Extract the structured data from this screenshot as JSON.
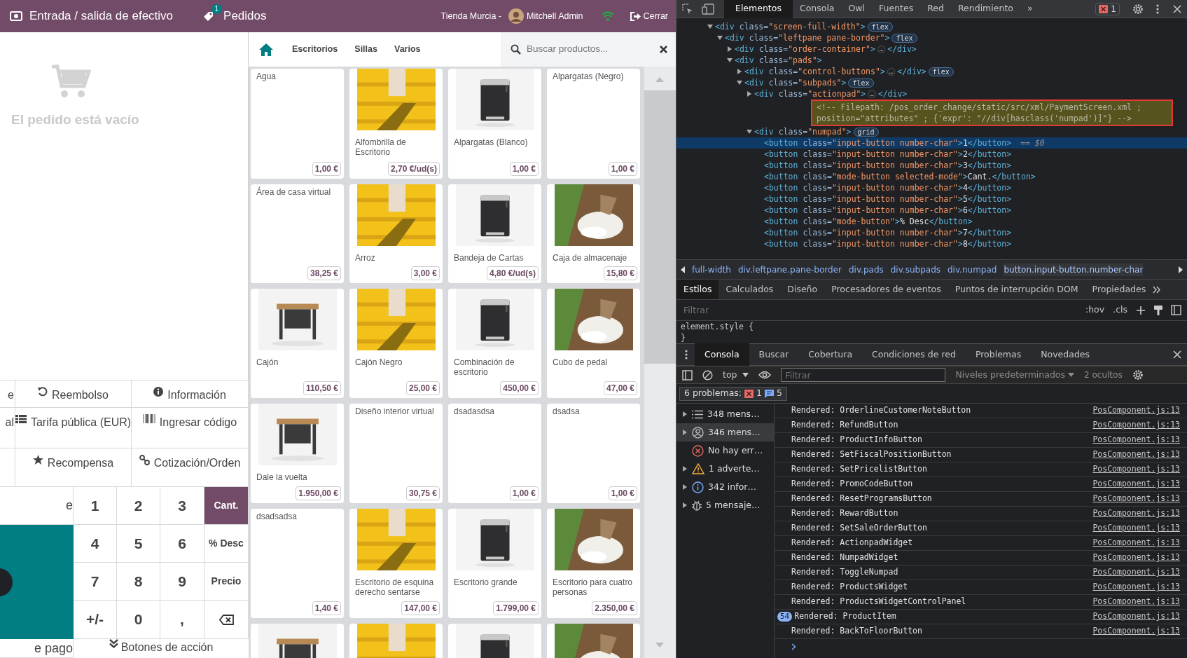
{
  "header": {
    "cash_label": "Entrada / salida de efectivo",
    "orders_count": "1",
    "orders_label": "Pedidos",
    "shop": "Tienda Murcia -",
    "user": "Mitchell Admin",
    "close_label": "Cerrar"
  },
  "order": {
    "empty_text": "El pedido está vacío"
  },
  "control_buttons": [
    [
      {
        "kind": "cut",
        "label": "e"
      },
      {
        "kind": "refund",
        "label": "Reembolso"
      },
      {
        "kind": "info",
        "label": "Información"
      }
    ],
    [
      {
        "kind": "cut",
        "label": "al"
      },
      {
        "kind": "pricelist",
        "label": "Tarifa pública (EUR)"
      },
      {
        "kind": "barcode",
        "label": "Ingresar código"
      }
    ],
    [
      {
        "kind": "cut"
      },
      {
        "kind": "reward",
        "label": "Recompensa"
      },
      {
        "kind": "link",
        "label": "Cotización/Orden"
      }
    ]
  ],
  "numpad": {
    "side_top": "e",
    "side_bottom": "e pago",
    "actions_toggle": "Botones de acción",
    "keys": [
      {
        "kind": "digit",
        "label": "1",
        "selected": false
      },
      {
        "kind": "digit",
        "label": "2",
        "selected": false
      },
      {
        "kind": "digit",
        "label": "3",
        "selected": false
      },
      {
        "kind": "mode",
        "label": "Cant.",
        "selected": true
      },
      {
        "kind": "digit",
        "label": "4",
        "selected": false
      },
      {
        "kind": "digit",
        "label": "5",
        "selected": false
      },
      {
        "kind": "digit",
        "label": "6",
        "selected": false
      },
      {
        "kind": "mode",
        "label": "% Desc",
        "selected": false
      },
      {
        "kind": "digit",
        "label": "7",
        "selected": false
      },
      {
        "kind": "digit",
        "label": "8",
        "selected": false
      },
      {
        "kind": "digit",
        "label": "9",
        "selected": false
      },
      {
        "kind": "mode",
        "label": "Precio",
        "selected": false
      },
      {
        "kind": "digit",
        "label": "+/-",
        "selected": false
      },
      {
        "kind": "digit",
        "label": "0",
        "selected": false
      },
      {
        "kind": "digit",
        "label": ",",
        "selected": false
      },
      {
        "kind": "backspace",
        "selected": false
      }
    ]
  },
  "categories": [
    {
      "label": "Escritorios"
    },
    {
      "label": "Sillas"
    },
    {
      "label": "Varios"
    }
  ],
  "search": {
    "placeholder": "Buscar productos..."
  },
  "products": [
    {
      "kind": "plain",
      "name": "Agua",
      "price": "1,00 €"
    },
    {
      "kind": "picture",
      "name": "Alfombrilla de Escritorio",
      "price": "2,70 €/ud(s)"
    },
    {
      "kind": "picture",
      "name": "Alpargatas (Blanco)",
      "price": "1,00 €"
    },
    {
      "kind": "plain",
      "name": "Alpargatas (Negro)",
      "price": "1,00 €"
    },
    {
      "kind": "plain",
      "name": "Área de casa virtual",
      "price": "38,25 €"
    },
    {
      "kind": "picture",
      "name": "Arroz",
      "price": "3,00 €"
    },
    {
      "kind": "picture",
      "name": "Bandeja de Cartas",
      "price": "4,80 €/ud(s)"
    },
    {
      "kind": "picture",
      "name": "Caja de almacenaje",
      "price": "15,80 €"
    },
    {
      "kind": "picture",
      "name": "Cajón",
      "price": "110,50 €"
    },
    {
      "kind": "picture",
      "name": "Cajón Negro",
      "price": "25,00 €"
    },
    {
      "kind": "picture",
      "name": "Combinación de escritorio",
      "price": "450,00 €"
    },
    {
      "kind": "picture",
      "name": "Cubo de pedal",
      "price": "47,00 €"
    },
    {
      "kind": "picture",
      "name": "Dale la vuelta",
      "price": "1.950,00 €"
    },
    {
      "kind": "plain",
      "name": "Diseño interior virtual",
      "price": "30,75 €"
    },
    {
      "kind": "plain",
      "name": "dsadasdsa",
      "price": "1,00 €"
    },
    {
      "kind": "plain",
      "name": "dsadsa",
      "price": "1,00 €"
    },
    {
      "kind": "plain",
      "name": "dsadsadsa",
      "price": "1,40 €"
    },
    {
      "kind": "picture",
      "name": "Escritorio de esquina derecho sentarse",
      "price": "147,00 €"
    },
    {
      "kind": "picture",
      "name": "Escritorio grande",
      "price": "1.799,00 €"
    },
    {
      "kind": "picture",
      "name": "Escritorio para cuatro personas",
      "price": "2.350,00 €"
    },
    {
      "kind": "picture"
    },
    {
      "kind": "picture"
    },
    {
      "kind": "picture"
    },
    {
      "kind": "picture"
    }
  ],
  "devtools": {
    "tabs": [
      {
        "label": "Elementos",
        "selected": true
      },
      {
        "label": "Consola",
        "selected": false
      },
      {
        "label": "Owl",
        "selected": false
      },
      {
        "label": "Fuentes",
        "selected": false
      },
      {
        "label": "Red",
        "selected": false
      },
      {
        "label": "Rendimiento",
        "selected": false
      }
    ],
    "more_tabs": "»",
    "issue_count": "1",
    "tree": [
      {
        "open": "<div class=\"screen-full-width\">",
        "badge": "flex",
        "expanded": true,
        "selected": false,
        "children": [
          {
            "open": "<div class=\"leftpane pane-border\">",
            "badge": "flex",
            "expanded": true,
            "selected": false,
            "children": [
              {
                "open": "<div class=\"order-container\">",
                "ellipsis": "…",
                "close": "</div>",
                "expanded": false,
                "selected": false
              },
              {
                "open": "<div class=\"pads\">",
                "expanded": true,
                "selected": false,
                "children": [
                  {
                    "open": "<div class=\"control-buttons\">",
                    "ellipsis": "…",
                    "close": "</div>",
                    "badge": "flex",
                    "expanded": false,
                    "selected": false
                  },
                  {
                    "open": "<div class=\"subpads\">",
                    "badge": "flex",
                    "expanded": true,
                    "selected": false,
                    "children": [
                      {
                        "open": "<div class=\"actionpad\">",
                        "ellipsis": "…",
                        "close": "</div>",
                        "expanded": false,
                        "selected": false
                      },
                      {
                        "kind": "comment",
                        "lines": [
                          "<!-- Filepath: /pos_order_change/static/src/xml/PaymentScreen.xml ;",
                          "position=\"attributes\" ; {'expr': \"//div[hasclass('numpad')]\"} -->"
                        ]
                      },
                      {
                        "open": "<div class=\"numpad\">",
                        "badge": "grid",
                        "expanded": true,
                        "selected": false,
                        "children": [
                          {
                            "open": "<button class=\"input-button number-char\">1</button>",
                            "note": "== $0",
                            "selected": true
                          },
                          {
                            "open": "<button class=\"input-button number-char\">2</button>",
                            "selected": false
                          },
                          {
                            "open": "<button class=\"input-button number-char\">3</button>",
                            "selected": false
                          },
                          {
                            "open": "<button class=\"mode-button selected-mode\">Cant.</button>",
                            "selected": false
                          },
                          {
                            "open": "<button class=\"input-button number-char\">4</button>",
                            "selected": false
                          },
                          {
                            "open": "<button class=\"input-button number-char\">5</button>",
                            "selected": false
                          },
                          {
                            "open": "<button class=\"input-button number-char\">6</button>",
                            "selected": false
                          },
                          {
                            "open": "<button class=\"mode-button\">% Desc</button>",
                            "selected": false
                          },
                          {
                            "open": "<button class=\"input-button number-char\">7</button>",
                            "selected": false
                          },
                          {
                            "open": "<button class=\"input-button number-char\">8</button>",
                            "selected": false
                          }
                        ]
                      }
                    ]
                  }
                ]
              }
            ]
          }
        ]
      }
    ],
    "breadcrumbs": [
      {
        "label": "full-width",
        "selected": false
      },
      {
        "label": "div.leftpane.pane-border",
        "selected": false
      },
      {
        "label": "div.pads",
        "selected": false
      },
      {
        "label": "div.subpads",
        "selected": false
      },
      {
        "label": "div.numpad",
        "selected": false
      },
      {
        "label": "button.input-button.number-char",
        "selected": true
      }
    ],
    "style_tabs": [
      {
        "label": "Estilos",
        "selected": true
      },
      {
        "label": "Calculados",
        "selected": false
      },
      {
        "label": "Diseño",
        "selected": false
      },
      {
        "label": "Procesadores de eventos",
        "selected": false
      },
      {
        "label": "Puntos de interrupción DOM",
        "selected": false
      },
      {
        "label": "Propiedades",
        "selected": false
      }
    ],
    "styles_filter": {
      "placeholder": "Filtrar"
    },
    "hov": ":hov",
    "cls": ".cls",
    "element_style": [
      "element.style {",
      "}"
    ],
    "console_tabs": [
      {
        "label": "Consola",
        "selected": true
      },
      {
        "label": "Buscar",
        "selected": false
      },
      {
        "label": "Cobertura",
        "selected": false
      },
      {
        "label": "Condiciones de red",
        "selected": false
      },
      {
        "label": "Problemas",
        "selected": false
      },
      {
        "label": "Novedades",
        "selected": false
      }
    ],
    "console_toolbar": {
      "context": "top",
      "filter_placeholder": "Filtrar",
      "levels": "Niveles predeterminados",
      "hidden": "2 ocultos"
    },
    "issues": {
      "label": "6 problemas:",
      "errors": "1",
      "infos": "5"
    },
    "sidebar": [
      {
        "kind": "messages",
        "label": "348 mens…",
        "expandable": true,
        "selected": false
      },
      {
        "kind": "user",
        "label": "346 mens…",
        "expandable": true,
        "selected": true
      },
      {
        "kind": "error",
        "label": "No hay err…",
        "expandable": false,
        "selected": false
      },
      {
        "kind": "warning",
        "label": "1 adverte…",
        "expandable": true,
        "selected": false
      },
      {
        "kind": "info",
        "label": "342 infor…",
        "expandable": true,
        "selected": false
      },
      {
        "kind": "verbose",
        "label": "5 mensaje…",
        "expandable": true,
        "selected": false
      }
    ],
    "messages": [
      {
        "text": "Rendered: OrderlineCustomerNoteButton",
        "source": "PosComponent.js:13"
      },
      {
        "text": "Rendered: RefundButton",
        "source": "PosComponent.js:13"
      },
      {
        "text": "Rendered: ProductInfoButton",
        "source": "PosComponent.js:13"
      },
      {
        "text": "Rendered: SetFiscalPositionButton",
        "source": "PosComponent.js:13"
      },
      {
        "text": "Rendered: SetPricelistButton",
        "source": "PosComponent.js:13"
      },
      {
        "text": "Rendered: PromoCodeButton",
        "source": "PosComponent.js:13"
      },
      {
        "text": "Rendered: ResetProgramsButton",
        "source": "PosComponent.js:13"
      },
      {
        "text": "Rendered: RewardButton",
        "source": "PosComponent.js:13"
      },
      {
        "text": "Rendered: SetSaleOrderButton",
        "source": "PosComponent.js:13"
      },
      {
        "text": "Rendered: ActionpadWidget",
        "source": "PosComponent.js:13"
      },
      {
        "text": "Rendered: NumpadWidget",
        "source": "PosComponent.js:13"
      },
      {
        "text": "Rendered: ToggleNumpad",
        "source": "PosComponent.js:13"
      },
      {
        "text": "Rendered: ProductsWidget",
        "source": "PosComponent.js:13"
      },
      {
        "text": "Rendered: ProductsWidgetControlPanel",
        "source": "PosComponent.js:13"
      },
      {
        "count": "54",
        "text": "Rendered: ProductItem",
        "source": "PosComponent.js:13"
      },
      {
        "text": "Rendered: BackToFloorButton",
        "source": "PosComponent.js:13"
      }
    ]
  }
}
